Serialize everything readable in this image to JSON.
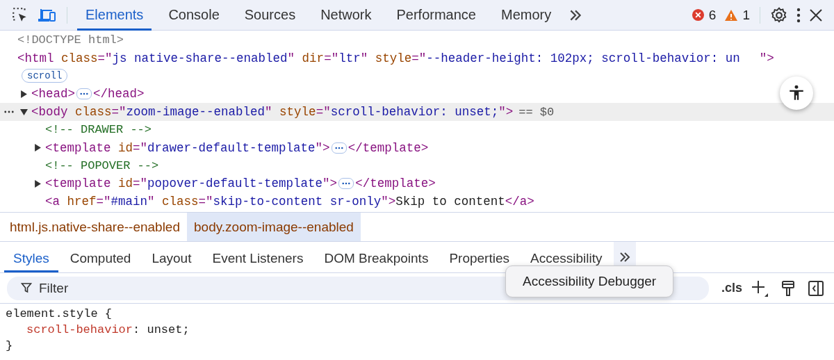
{
  "toolbar": {
    "tabs": [
      {
        "label": "Elements",
        "selected": true
      },
      {
        "label": "Console",
        "selected": false
      },
      {
        "label": "Sources",
        "selected": false
      },
      {
        "label": "Network",
        "selected": false
      },
      {
        "label": "Performance",
        "selected": false
      },
      {
        "label": "Memory",
        "selected": false
      }
    ],
    "errors": "6",
    "warnings": "1"
  },
  "dom": {
    "nodes": [
      {
        "kind": "doctype",
        "selected": false,
        "open": [
          {
            "doctype": "<!DOCTYPE html>"
          }
        ]
      },
      {
        "kind": "element",
        "selected": false,
        "open": [
          {
            "tag": "<html "
          },
          {
            "attr": "class"
          },
          {
            "tag": "=\""
          },
          {
            "val": "js native-share--enabled"
          },
          {
            "tag": "\" "
          },
          {
            "attr": "dir"
          },
          {
            "tag": "=\""
          },
          {
            "val": "ltr"
          },
          {
            "tag": "\" "
          },
          {
            "attr": "style"
          },
          {
            "tag": "=\""
          },
          {
            "val": "--header-height: 102px; scroll-behavior: un"
          }
        ],
        "tail": "\">",
        "badge": "scroll",
        "children": [
          {
            "kind": "element",
            "selected": false,
            "expanded": false,
            "open": [
              {
                "tag": "<head>"
              }
            ],
            "ellipsis": true,
            "close": "</head>"
          },
          {
            "kind": "element",
            "selected": true,
            "expanded": true,
            "open": [
              {
                "tag": "<body "
              },
              {
                "attr": "class"
              },
              {
                "tag": "=\""
              },
              {
                "val": "zoom-image--enabled"
              },
              {
                "tag": "\" "
              },
              {
                "attr": "style"
              },
              {
                "tag": "=\""
              },
              {
                "val": "scroll-behavior: unset;"
              },
              {
                "tag": "\">"
              }
            ],
            "marker": "== $0",
            "children": [
              {
                "kind": "comment",
                "selected": false,
                "open": [
                  {
                    "comment": "<!-- DRAWER -->"
                  }
                ]
              },
              {
                "kind": "element",
                "selected": false,
                "expanded": false,
                "open": [
                  {
                    "tag": "<template "
                  },
                  {
                    "attr": "id"
                  },
                  {
                    "tag": "=\""
                  },
                  {
                    "val": "drawer-default-template"
                  },
                  {
                    "tag": "\">"
                  }
                ],
                "ellipsis": true,
                "close": "</template>"
              },
              {
                "kind": "comment",
                "selected": false,
                "open": [
                  {
                    "comment": "<!-- POPOVER -->"
                  }
                ]
              },
              {
                "kind": "element",
                "selected": false,
                "expanded": false,
                "open": [
                  {
                    "tag": "<template "
                  },
                  {
                    "attr": "id"
                  },
                  {
                    "tag": "=\""
                  },
                  {
                    "val": "popover-default-template"
                  },
                  {
                    "tag": "\">"
                  }
                ],
                "ellipsis": true,
                "close": "</template>"
              },
              {
                "kind": "element",
                "selected": false,
                "open": [
                  {
                    "tag": "<a "
                  },
                  {
                    "attr": "href"
                  },
                  {
                    "tag": "=\""
                  },
                  {
                    "val": "#main"
                  },
                  {
                    "tag": "\" "
                  },
                  {
                    "attr": "class"
                  },
                  {
                    "tag": "=\""
                  },
                  {
                    "val": "skip-to-content sr-only"
                  },
                  {
                    "tag": "\">"
                  },
                  {
                    "text": "Skip to content"
                  },
                  {
                    "tag": "</a>"
                  }
                ]
              }
            ]
          }
        ]
      }
    ]
  },
  "breadcrumbs": [
    {
      "label": "html.js.native-share--enabled",
      "selected": false
    },
    {
      "label": "body.zoom-image--enabled",
      "selected": true
    }
  ],
  "panel_tabs": [
    {
      "label": "Styles",
      "selected": true
    },
    {
      "label": "Computed",
      "selected": false
    },
    {
      "label": "Layout",
      "selected": false
    },
    {
      "label": "Event Listeners",
      "selected": false
    },
    {
      "label": "DOM Breakpoints",
      "selected": false
    },
    {
      "label": "Properties",
      "selected": false
    },
    {
      "label": "Accessibility",
      "selected": false
    }
  ],
  "filter": {
    "placeholder": "Filter"
  },
  "cls": ".cls",
  "tooltip": "Accessibility Debugger",
  "rule": {
    "selector": "element.style",
    "open": "{",
    "property": "scroll-behavior",
    "separator": ":",
    "value": "unset;",
    "close": "}"
  }
}
